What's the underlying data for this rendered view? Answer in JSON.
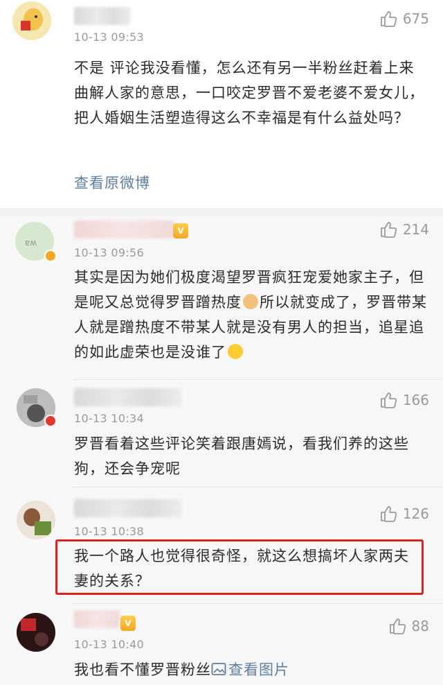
{
  "comments": [
    {
      "timestamp": "10-13 09:53",
      "likes": "675",
      "text": "不是 评论我没看懂，怎么还有另一半粉丝赶着上来曲解人家的意思，一口咬定罗晋不爱老婆不爱女儿，把人婚姻生活塑造得这么不幸福是有什么益处吗？",
      "link": "查看原微博"
    },
    {
      "timestamp": "10-13 09:56",
      "likes": "214",
      "text_before_emoji1": "其实是因为她们极度渴望罗晋疯狂宠爱她家主子，但是呢又总觉得罗晋蹭热度",
      "text_between_emojis": "所以就变成了，罗晋带某人就是蹭热度不带某人就是没有男人的担当，追星追的如此虚荣也是没谁了",
      "emoji1": "cat-face-emoji",
      "emoji2": "laughing-face-emoji"
    },
    {
      "timestamp": "10-13 10:34",
      "likes": "166",
      "text": "罗晋看着这些评论笑着跟唐嫣说，看我们养的这些狗，还会争宠呢"
    },
    {
      "timestamp": "10-13 10:38",
      "likes": "126",
      "text": "我一个路人也觉得很奇怪，就这么想搞坏人家两夫妻的关系？"
    },
    {
      "timestamp": "10-13 10:40",
      "likes": "88",
      "text": "我也看不懂罗晋粉丝",
      "image_link": "查看图片"
    }
  ],
  "colors": {
    "link": "#5e7e9e",
    "highlight_border": "#e02020",
    "timestamp": "#9a9a9a"
  }
}
